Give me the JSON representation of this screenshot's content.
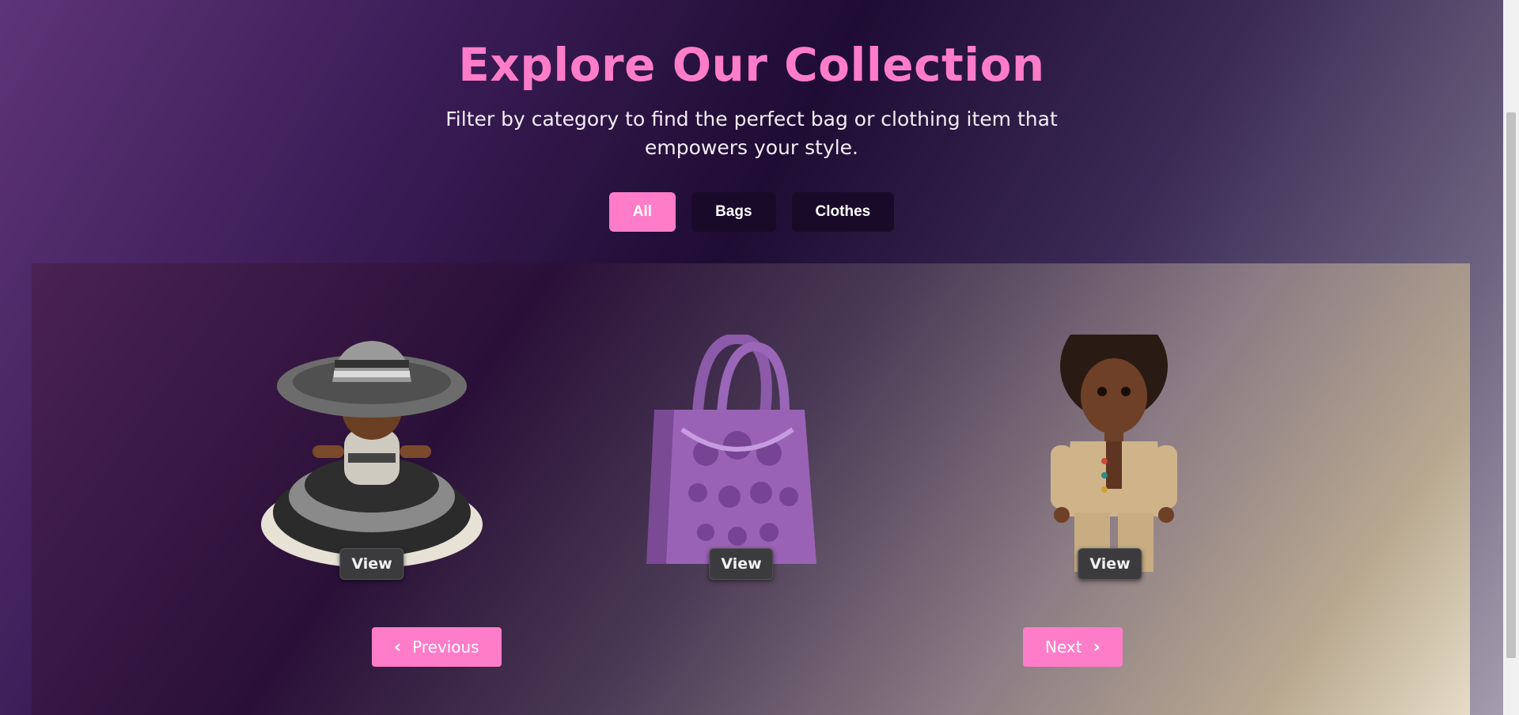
{
  "header": {
    "title": "Explore Our Collection",
    "subtitle": "Filter by category to find the perfect bag or clothing item that empowers your style."
  },
  "filters": [
    {
      "label": "All",
      "active": true
    },
    {
      "label": "Bags",
      "active": false
    },
    {
      "label": "Clothes",
      "active": false
    }
  ],
  "products": [
    {
      "name": "crochet doll with hat and ruffled dress",
      "view_label": "View"
    },
    {
      "name": "purple crochet tote bag",
      "view_label": "View"
    },
    {
      "name": "doll in knitted outfit",
      "view_label": "View"
    }
  ],
  "pagination": {
    "previous_label": "Previous",
    "next_label": "Next"
  },
  "colors": {
    "accent": "#ff7cc9",
    "filter_bg": "#1a0a2a",
    "view_btn_bg": "#3b3b3e"
  }
}
